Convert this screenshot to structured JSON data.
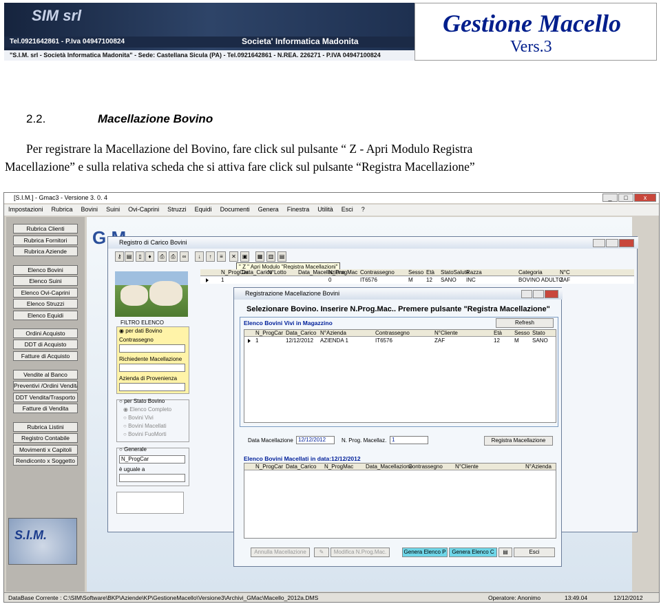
{
  "banner": {
    "logo": "SIM srl",
    "phone_line": "Tel.0921642861 - P.Iva 04947100824",
    "company": "Societa' Informatica Madonita",
    "footer_line": "\"S.I.M. srl - Società Informatica Madonita\" - Sede: Castellana Sicula (PA) - Tel.0921642861 - N.REA. 226271 - P.IVA 04947100824"
  },
  "doc": {
    "title": "Gestione Macello",
    "version": "Vers.3",
    "section_number": "2.2.",
    "section_title": "Macellazione Bovino",
    "paragraph_line1": "Per registrare la Macellazione del Bovino, fare click sul pulsante “ Z   - Apri Modulo Registra",
    "paragraph_line2": "Macellazione” e sulla relativa scheda che si attiva fare click sul pulsante “Registra Macellazione”"
  },
  "app": {
    "title": "[S.I.M.] - Gmac3 - Versione  3. 0. 4",
    "window_buttons": [
      "_",
      "□",
      "x"
    ],
    "menu": [
      "Impostazioni",
      "Rubrica",
      "Bovini",
      "Suini",
      "Ovi-Caprini",
      "Struzzi",
      "Equidi",
      "Documenti",
      "Genera",
      "Finestra",
      "Utilità",
      "Esci",
      "?"
    ],
    "sidebar": [
      "Rubrica Clienti",
      "Rubrica Fornitori",
      "Rubrica Aziende",
      "Elenco Bovini",
      "Elenco Suini",
      "Elenco Ovi-Caprini",
      "Elenco Struzzi",
      "Elenco Equidi",
      "Ordini Acquisto",
      "DDT di Acquisto",
      "Fatture di Acquisto",
      "Vendite al Banco",
      "Preventivi /Ordini Vendita",
      "DDT Vendita/Trasporto",
      "Fatture di Vendita",
      "Rubrica Listini",
      "Registro Contabile",
      "Movimenti x Capitoli",
      "Rendiconto x Soggetto"
    ],
    "logo": "S.I.M.",
    "bg_title": "G.M.",
    "status": {
      "database": "DataBase Corrente : C:\\SIM\\Software\\BKP\\Aziende\\KP\\GestioneMacello\\Versione3\\Archivi_GMac\\Macello_2012a.DMS",
      "operator": "Operatore: Anonimo",
      "time": "13:49.04",
      "date": "12/12/2012"
    }
  },
  "registro": {
    "title": "Registro di Carico Bovini",
    "toolbar_tip": "\" Z \"  Apri Modulo \"Registra Macellazioni\"",
    "filter": {
      "title": "FILTRO ELENCO",
      "by_data": "per dati Bovino",
      "contrassegno": "Contrassegno",
      "richiedente": "Richiedente Macellazione",
      "azienda": "Azienda di Provenienza",
      "by_stato": "per Stato Bovino",
      "stati": [
        "Elenco Completo",
        "Bovini Vivi",
        "Bovini Macellati",
        "Bovini FuoMorti"
      ],
      "generale": "Generale",
      "campo": "N_ProgCar",
      "uguale": "è uguale a"
    },
    "columns": [
      "N_ProgCar",
      "Data_Carico",
      "N°Lotto",
      "Data_Macellazione",
      "N_ProgMac",
      "Contrassegno",
      "Sesso",
      "Età",
      "StatoSalute",
      "Razza",
      "Categoria",
      "N°C"
    ],
    "row": [
      "1",
      "",
      "",
      "",
      "0",
      "IT6576",
      "M",
      "12",
      "SANO",
      "INC",
      "BOVINO ADULTO",
      "ZAF"
    ]
  },
  "dialog": {
    "title": "Registrazione  Macellazione Bovini",
    "heading": "Selezionare Bovino. Inserire N.Prog.Mac.. Premere pulsante \"Registra Macellazione\"",
    "vivi_title": "Elenco Bovini Vivi in Magazzino",
    "refresh": "Refresh",
    "vivi_columns": [
      "N_ProgCar",
      "Data_Carico",
      "N°Azienda",
      "Contrassegno",
      "N°Cliente",
      "Età",
      "Sesso",
      "Stato"
    ],
    "vivi_row": [
      "1",
      "12/12/2012",
      "AZIENDA 1",
      "IT6576",
      "ZAF",
      "12",
      "M",
      "SANO"
    ],
    "data_label": "Data Macellazione",
    "data_value": "12/12/2012",
    "prog_label": "N. Prog. Macellaz.",
    "prog_value": "1",
    "registra": "Registra Macellazione",
    "macellati_title": "Elenco Bovini Macellati in data:12/12/2012",
    "mac_columns": [
      "N_ProgCar",
      "Data_Carico",
      "N_ProgMac",
      "Data_Macellazione",
      "Contrassegno",
      "N°Cliente",
      "N°Azienda"
    ],
    "footer_buttons": [
      "Annulla Macellazione",
      "Modifica N.Prog.Mac.",
      "Genera Elenco P",
      "Genera Elenco C",
      "Esci"
    ]
  }
}
